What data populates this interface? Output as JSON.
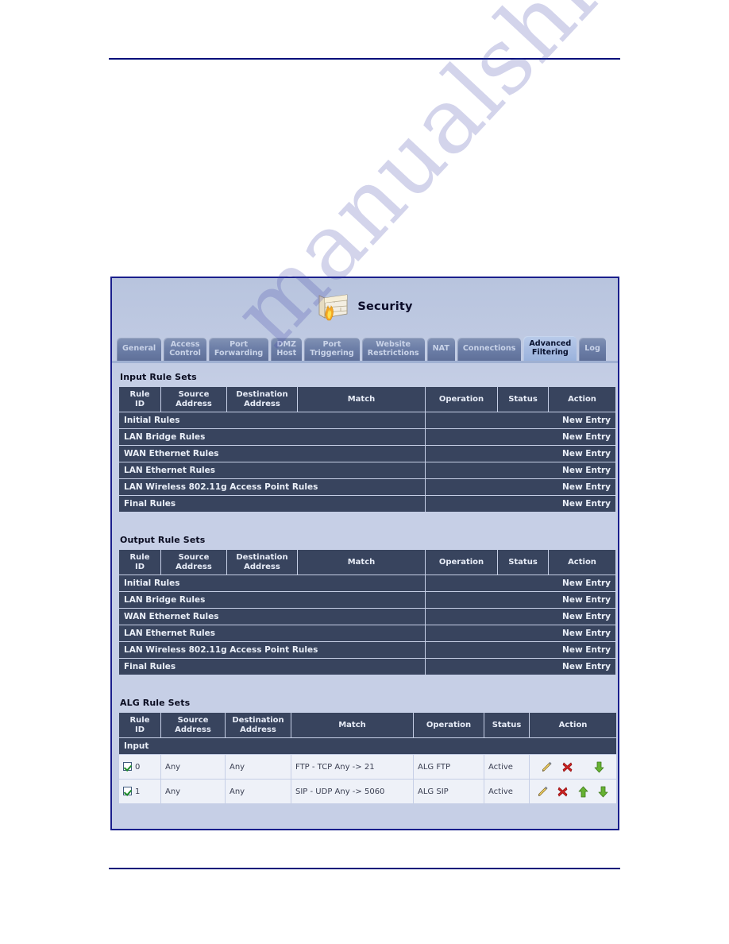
{
  "panel": {
    "title": "Security",
    "icon": "firewall-icon"
  },
  "tabs": [
    {
      "id": "general",
      "label": "General",
      "line1": "General",
      "line2": "",
      "active": false
    },
    {
      "id": "access-control",
      "label": "Access Control",
      "line1": "Access",
      "line2": "Control",
      "active": false
    },
    {
      "id": "port-forwarding",
      "label": "Port Forwarding",
      "line1": "Port",
      "line2": "Forwarding",
      "active": false
    },
    {
      "id": "dmz-host",
      "label": "DMZ Host",
      "line1": "DMZ",
      "line2": "Host",
      "active": false
    },
    {
      "id": "port-triggering",
      "label": "Port Triggering",
      "line1": "Port",
      "line2": "Triggering",
      "active": false
    },
    {
      "id": "website-restrictions",
      "label": "Website Restrictions",
      "line1": "Website",
      "line2": "Restrictions",
      "active": false
    },
    {
      "id": "nat",
      "label": "NAT",
      "line1": "NAT",
      "line2": "",
      "active": false
    },
    {
      "id": "connections",
      "label": "Connections",
      "line1": "Connections",
      "line2": "",
      "active": false
    },
    {
      "id": "advanced-filtering",
      "label": "Advanced Filtering",
      "line1": "Advanced",
      "line2": "Filtering",
      "active": true
    },
    {
      "id": "log",
      "label": "Log",
      "line1": "Log",
      "line2": "",
      "active": false
    }
  ],
  "columns": {
    "rule_id_l1": "Rule",
    "rule_id_l2": "ID",
    "source_l1": "Source",
    "source_l2": "Address",
    "dest_l1": "Destination",
    "dest_l2": "Address",
    "match": "Match",
    "operation": "Operation",
    "status": "Status",
    "action": "Action"
  },
  "new_entry_label": "New Entry",
  "input_section": {
    "title": "Input Rule Sets",
    "rule_sets": [
      "Initial Rules",
      "LAN Bridge Rules",
      "WAN Ethernet Rules",
      "LAN Ethernet Rules",
      "LAN Wireless 802.11g Access Point Rules",
      "Final Rules"
    ]
  },
  "output_section": {
    "title": "Output Rule Sets",
    "rule_sets": [
      "Initial Rules",
      "LAN Bridge Rules",
      "WAN Ethernet Rules",
      "LAN Ethernet Rules",
      "LAN Wireless 802.11g Access Point Rules",
      "Final Rules"
    ]
  },
  "alg_section": {
    "title": "ALG Rule Sets",
    "subhead": "Input",
    "rows": [
      {
        "checked": true,
        "rule_id": "0",
        "source": "Any",
        "destination": "Any",
        "match": "FTP - TCP Any -> 21",
        "operation": "ALG FTP",
        "status": "Active",
        "actions": [
          "edit-icon",
          "delete-icon",
          "move-down-icon"
        ]
      },
      {
        "checked": true,
        "rule_id": "1",
        "source": "Any",
        "destination": "Any",
        "match": "SIP - UDP Any -> 5060",
        "operation": "ALG SIP",
        "status": "Active",
        "actions": [
          "edit-icon",
          "delete-icon",
          "move-up-icon",
          "move-down-icon"
        ]
      }
    ]
  },
  "watermark": {
    "text": "manualshive.com"
  },
  "colors": {
    "panel_border": "#1a1f8c",
    "header_cell": "#38445e",
    "active_tab": "#a7bce2",
    "status_active": "#2f7d32",
    "page_rule": "#000f7a"
  }
}
